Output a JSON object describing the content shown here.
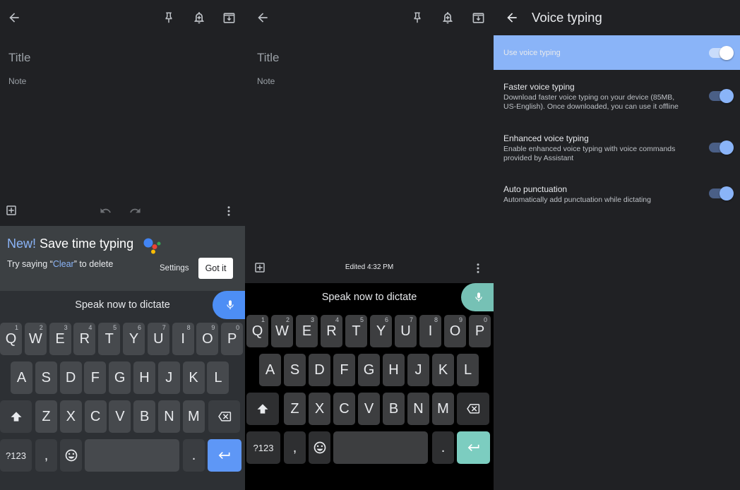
{
  "note_editor": {
    "title_placeholder": "Title",
    "note_placeholder": "Note",
    "edited_label": "Edited 4:32 PM"
  },
  "suggestion": {
    "new_label": "New!",
    "headline": " Save time typing",
    "hint_prefix": "Try saying “",
    "hint_word": "Clear",
    "hint_suffix": "” to delete",
    "settings_label": "Settings",
    "got_it_label": "Got it"
  },
  "keyboard": {
    "dictation_prompt": "Speak now to dictate",
    "row1": [
      {
        "k": "Q",
        "s": "1"
      },
      {
        "k": "W",
        "s": "2"
      },
      {
        "k": "E",
        "s": "3"
      },
      {
        "k": "R",
        "s": "4"
      },
      {
        "k": "T",
        "s": "5"
      },
      {
        "k": "Y",
        "s": "6"
      },
      {
        "k": "U",
        "s": "7"
      },
      {
        "k": "I",
        "s": "8"
      },
      {
        "k": "O",
        "s": "9"
      },
      {
        "k": "P",
        "s": "0"
      }
    ],
    "row2": [
      "A",
      "S",
      "D",
      "F",
      "G",
      "H",
      "J",
      "K",
      "L"
    ],
    "row3": [
      "Z",
      "X",
      "C",
      "V",
      "B",
      "N",
      "M"
    ],
    "symbols_label": "?123",
    "comma": ",",
    "period": "."
  },
  "settings": {
    "title": "Voice typing",
    "items": [
      {
        "label": "Use voice typing",
        "description": "",
        "enabled": true,
        "highlighted": true
      },
      {
        "label": "Faster voice typing",
        "description": "Download faster voice typing on your device (85MB, US-English). Once downloaded, you can use it offline",
        "enabled": true,
        "highlighted": false
      },
      {
        "label": "Enhanced voice typing",
        "description": "Enable enhanced voice typing with voice commands provided by Assistant",
        "enabled": true,
        "highlighted": false
      },
      {
        "label": "Auto punctuation",
        "description": "Automatically add punctuation while dictating",
        "enabled": true,
        "highlighted": false
      }
    ]
  },
  "icons": {
    "back": "arrow-left-icon",
    "pin": "pin-icon",
    "reminder": "bell-plus-icon",
    "archive": "archive-icon",
    "add": "add-box-icon",
    "undo": "undo-icon",
    "redo": "redo-icon",
    "more": "more-vert-icon",
    "mic": "mic-icon",
    "shift": "shift-icon",
    "backspace": "backspace-icon",
    "emoji": "emoji-icon",
    "enter": "enter-icon"
  },
  "colors": {
    "background": "#202124",
    "accent_blue": "#8ab4f8",
    "mic_blue": "#4d8ef5",
    "mic_teal": "#76c1b5",
    "enter_teal": "#7ccdc0"
  }
}
